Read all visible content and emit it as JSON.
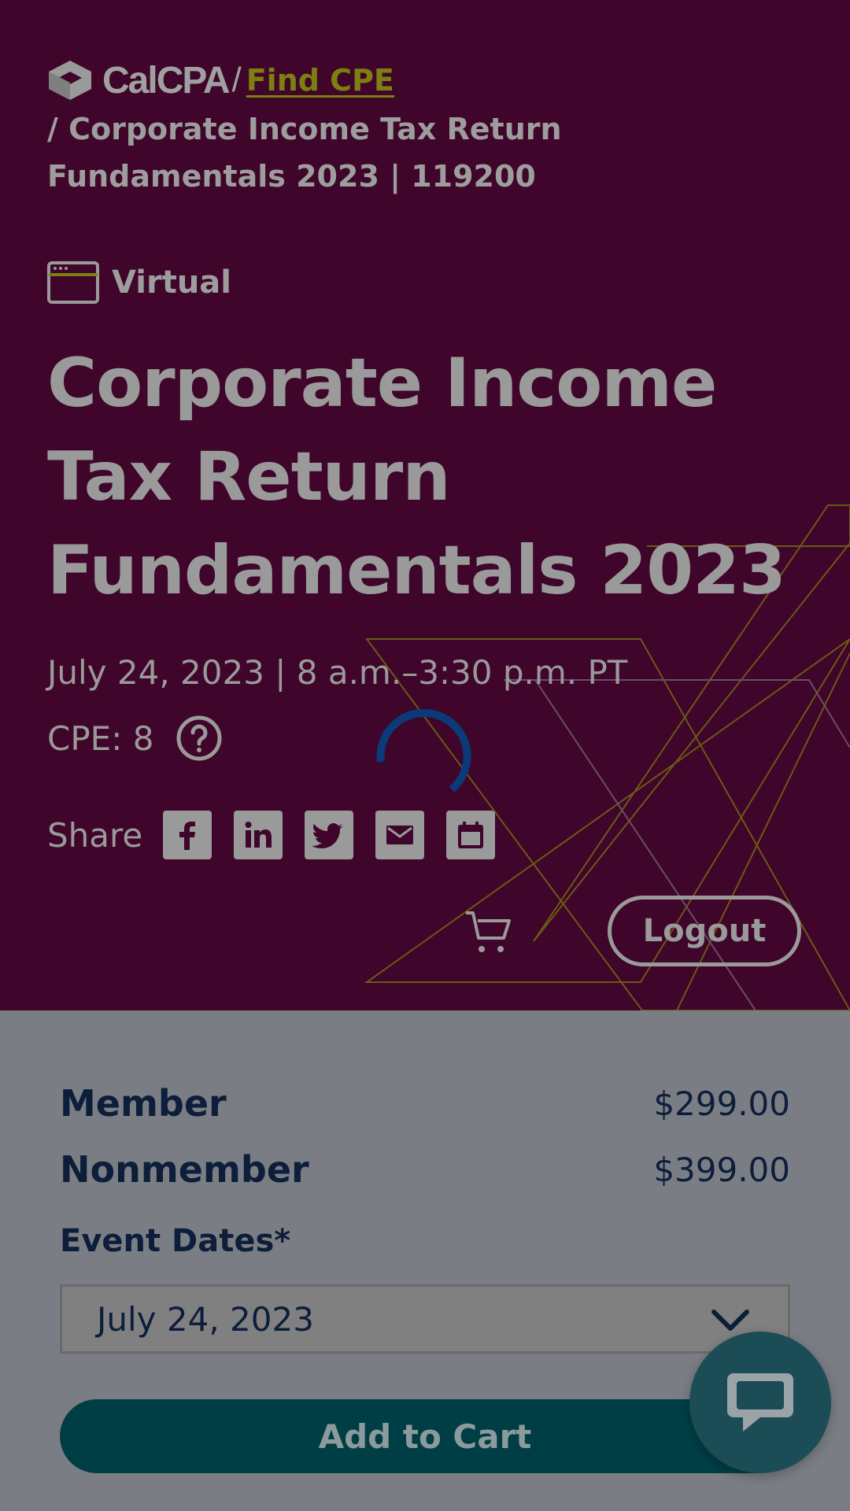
{
  "breadcrumb": {
    "logo_text": "CalCPA",
    "separator": "/",
    "find_link": "Find CPE",
    "current_line1": "/ Corporate Income Tax Return",
    "current_line2": "Fundamentals 2023 | 119200"
  },
  "event": {
    "format": "Virtual",
    "title_line1": "Corporate Income",
    "title_line2": "Tax Return",
    "title_line3": "Fundamentals 2023",
    "datetime": "July 24, 2023 | 8 a.m.–3:30 p.m. PT",
    "cpe": "CPE: 8"
  },
  "share": {
    "label": "Share",
    "icons": [
      "facebook-icon",
      "linkedin-icon",
      "twitter-icon",
      "email-icon",
      "calendar-icon"
    ]
  },
  "header_actions": {
    "logout_label": "Logout"
  },
  "pricing": {
    "member_label": "Member",
    "member_price": "$299.00",
    "nonmember_label": "Nonmember",
    "nonmember_price": "$399.00"
  },
  "event_dates": {
    "label": "Event Dates*",
    "selected": "July 24, 2023"
  },
  "actions": {
    "add_to_cart": "Add to Cart"
  },
  "colors": {
    "hero_bg": "#3f052a",
    "link": "#7d7f10",
    "button_primary": "#003e45",
    "chat_bg": "#1c4d56",
    "spinner": "#0b3a78"
  }
}
